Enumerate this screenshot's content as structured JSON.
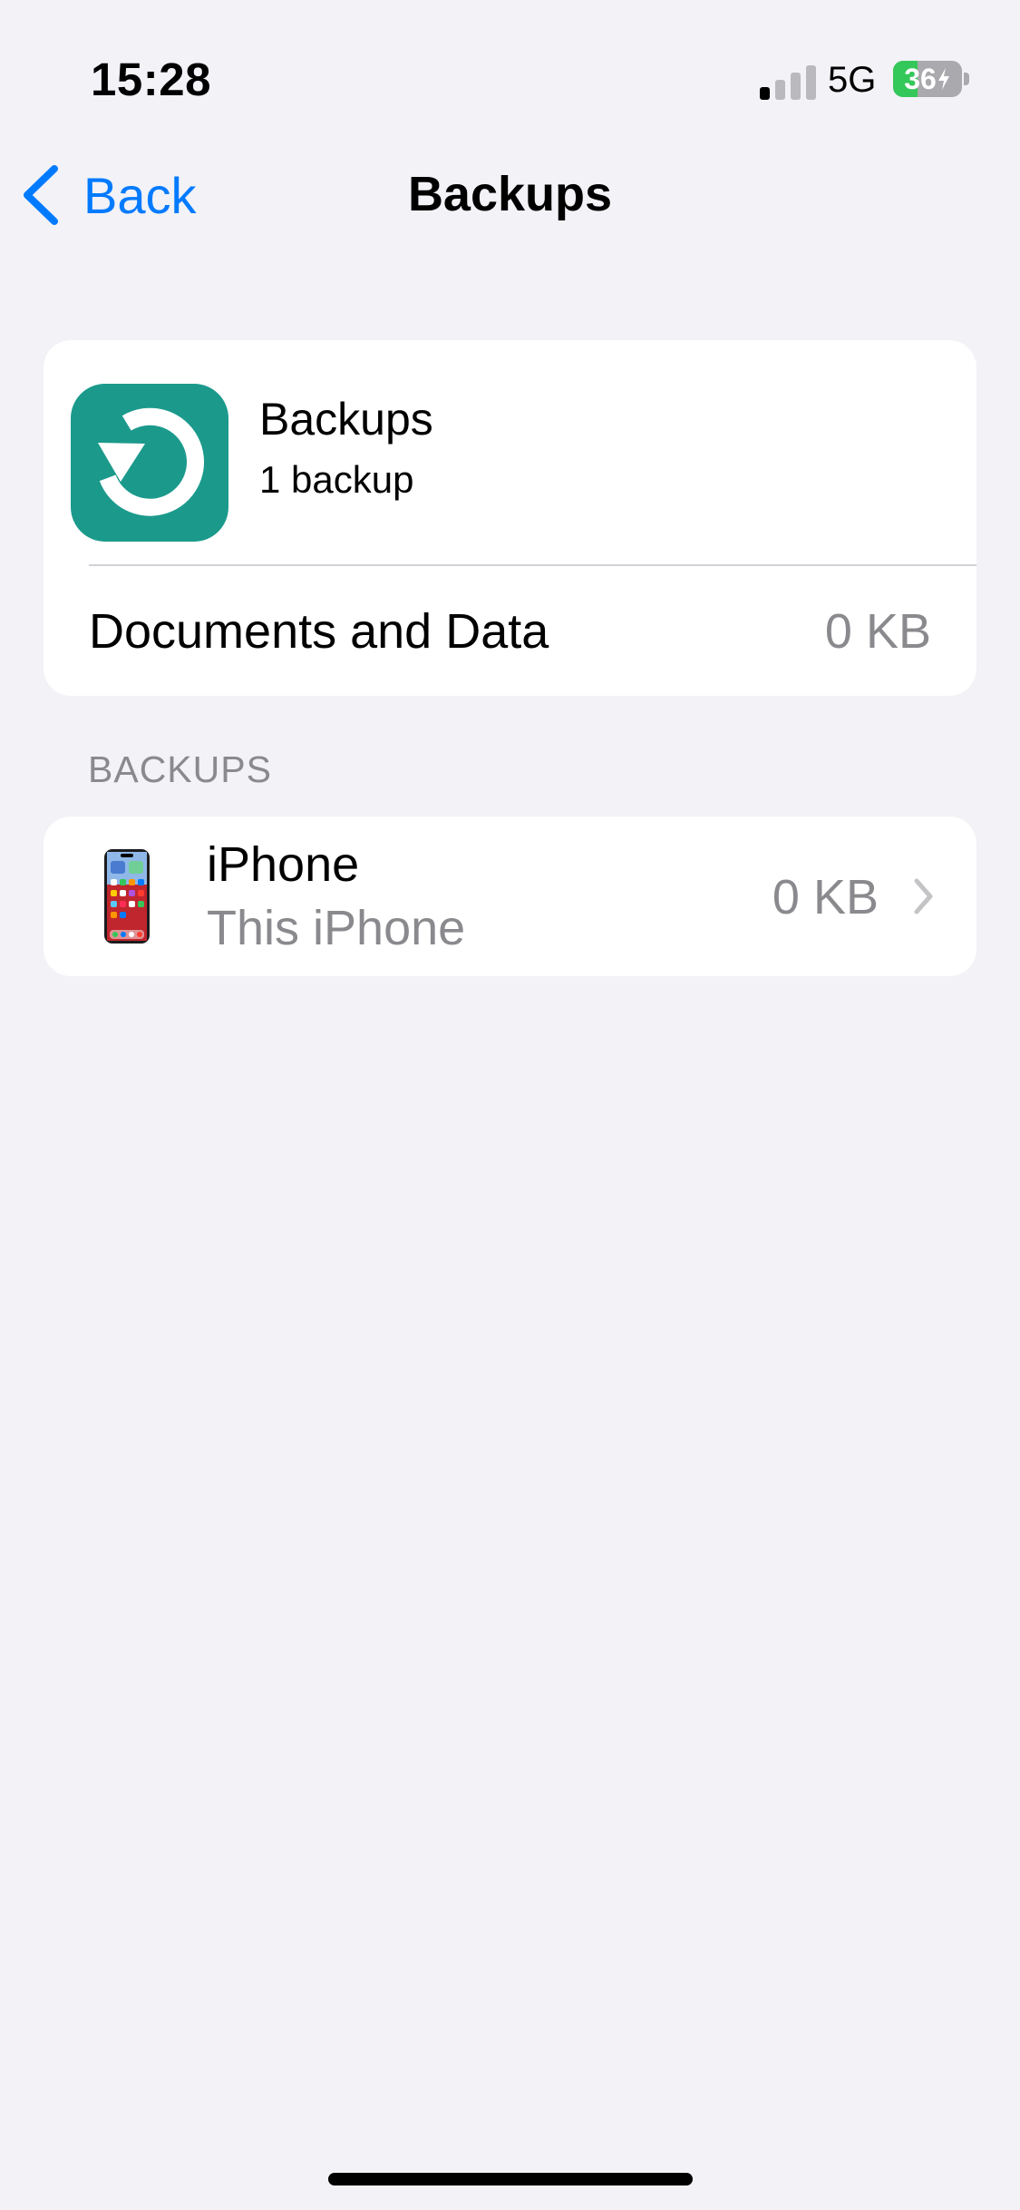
{
  "status_bar": {
    "time": "15:28",
    "network": "5G",
    "battery_percent": "36",
    "battery_level": 0.36,
    "signal_bars_active": 1,
    "signal_bars_total": 4
  },
  "nav": {
    "back_label": "Back",
    "title": "Backups"
  },
  "header_card": {
    "icon": "backup-restore-icon",
    "icon_color": "#1B9A8C",
    "title": "Backups",
    "subtitle": "1 backup",
    "documents_label": "Documents and Data",
    "documents_value": "0 KB"
  },
  "backups_section": {
    "header": "BACKUPS",
    "items": [
      {
        "icon": "iphone-thumbnail-icon",
        "name": "iPhone",
        "subtitle": "This iPhone",
        "size": "0 KB"
      }
    ]
  },
  "colors": {
    "accent": "#007AFF",
    "background": "#F2F2F7",
    "battery_green": "#34C759"
  }
}
